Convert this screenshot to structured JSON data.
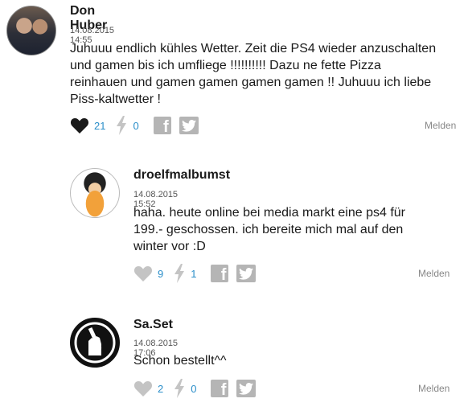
{
  "comments": [
    {
      "author": "Don Huber",
      "timestamp": "14.08.2015 14:55",
      "text": "Juhuuu endlich kühles Wetter. Zeit die PS4 wieder anzuschalten\nund gamen bis ich umfliege !!!!!!!!!! Dazu ne fette Pizza\nreinhauen und gamen gamen gamen gamen !! Juhuuu ich liebe\nPiss-kaltwetter !",
      "likes": "21",
      "bolts": "0",
      "report_label": "Melden",
      "liked": true
    },
    {
      "author": "droelfmalbumst",
      "timestamp": "14.08.2015 15:52",
      "text": "haha. heute online bei media markt eine ps4 für\n199.- geschossen. ich bereite mich mal auf den\nwinter vor :D",
      "likes": "9",
      "bolts": "1",
      "report_label": "Melden",
      "liked": false
    },
    {
      "author": "Sa.Set",
      "timestamp": "14.08.2015 17:06",
      "text": "Schon bestellt^^",
      "likes": "2",
      "bolts": "0",
      "report_label": "Melden",
      "liked": false
    }
  ],
  "icons": {
    "like": "heart-icon",
    "bolt": "lightning-icon",
    "facebook": "facebook-icon",
    "twitter": "twitter-icon"
  },
  "colors": {
    "count": "#2a8ec9",
    "heart_active": "#1a1a1a",
    "icon_inactive": "#b5b5b5"
  }
}
